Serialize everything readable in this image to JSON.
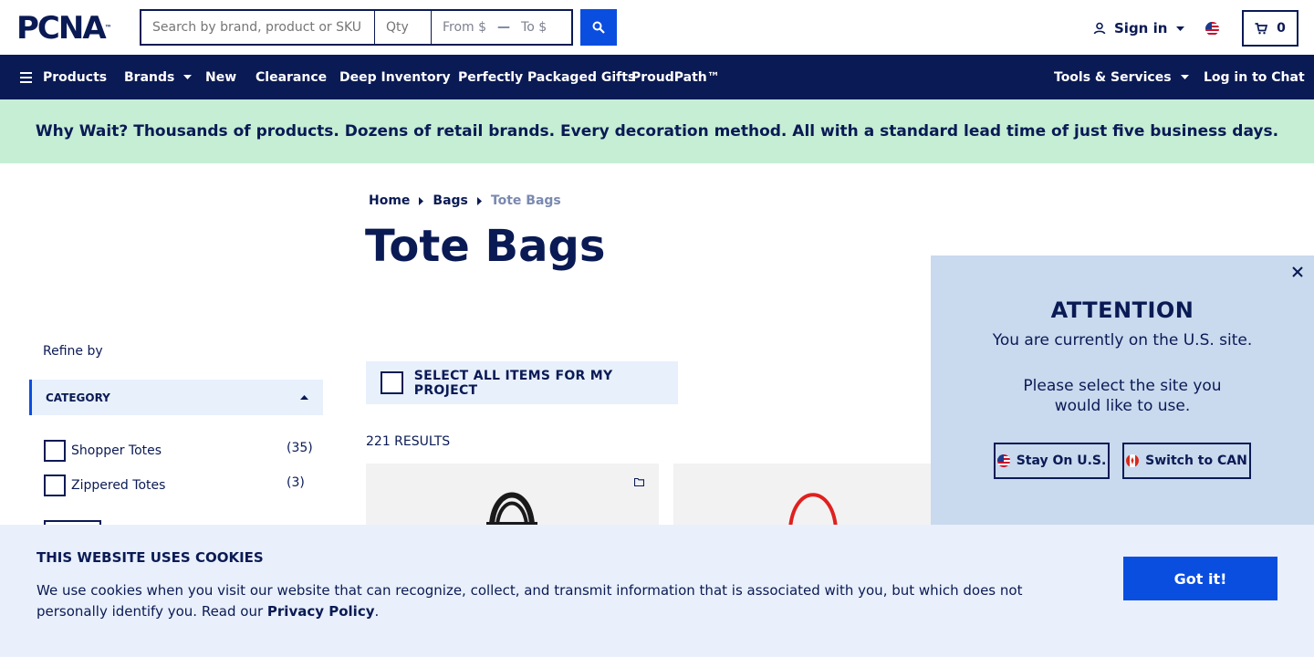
{
  "header": {
    "logo_text": "PCNA",
    "logo_tm": "™",
    "search_placeholder": "Search by brand, product or SKU",
    "qty_placeholder": "Qty",
    "price_from": "From $",
    "price_dash": "—",
    "price_to": "To $",
    "sign_in": "Sign in",
    "cart_count": "0"
  },
  "nav": {
    "products": "Products",
    "brands": "Brands",
    "new": "New",
    "clearance": "Clearance",
    "deep_inventory": "Deep Inventory",
    "gifts": "Perfectly Packaged Gifts",
    "proudpath": "ProudPath™",
    "tools": "Tools & Services",
    "chat": "Log in to Chat"
  },
  "banner": {
    "lead": "Why Wait?",
    "text": "Thousands of products. Dozens of retail brands. Every decoration method. All with a standard lead time of just five business days."
  },
  "breadcrumb": [
    "Home",
    "Bags",
    "Tote Bags"
  ],
  "page_title": "Tote Bags",
  "sidebar": {
    "refine_label": "Refine by",
    "category_label": "CATEGORY",
    "filters": [
      {
        "label": "Shopper Totes",
        "count": "(35)"
      },
      {
        "label": "Zippered Totes",
        "count": "(3)"
      }
    ]
  },
  "main": {
    "select_all": "SELECT ALL ITEMS FOR MY PROJECT",
    "results": "221 RESULTS"
  },
  "modal": {
    "title": "ATTENTION",
    "line1": "You are currently on the U.S. site.",
    "line2": "Please select the site you would like to use.",
    "stay": "Stay On U.S.",
    "switch": "Switch to CAN"
  },
  "cookie": {
    "title": "THIS WEBSITE USES COOKIES",
    "text": "We use cookies when you visit our website that can recognize, collect, and transmit information that is associated with you, but which does not personally identify you. Read our ",
    "link": "Privacy Policy",
    "end": ".",
    "button": "Got it!"
  },
  "colors": {
    "navy": "#0a1a54",
    "blue": "#0a4ee0",
    "banner": "#c5eed4",
    "modal": "#c9d9ee",
    "cookie": "#e9f0fb"
  }
}
